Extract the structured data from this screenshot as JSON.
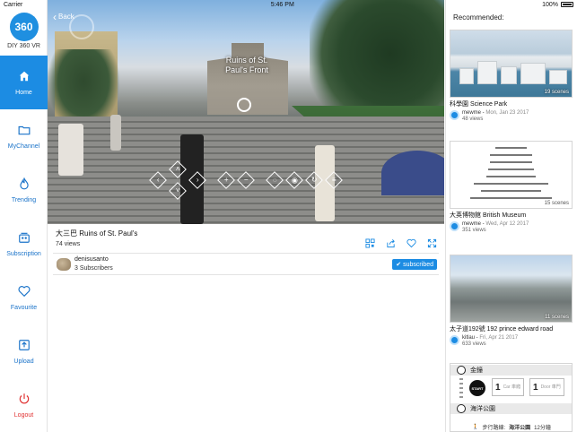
{
  "status_bar": {
    "carrier": "Carrier",
    "time": "5:46 PM",
    "battery": "100%"
  },
  "app": {
    "name": "DIY 360 VR",
    "logo_text": "360"
  },
  "sidebar": {
    "items": [
      {
        "label": "Home",
        "icon": "home-icon",
        "active": true
      },
      {
        "label": "MyChannel",
        "icon": "folder-icon"
      },
      {
        "label": "Trending",
        "icon": "flame-icon"
      },
      {
        "label": "Subscription",
        "icon": "subscription-icon"
      },
      {
        "label": "Favourite",
        "icon": "heart-icon"
      },
      {
        "label": "Upload",
        "icon": "upload-icon"
      },
      {
        "label": "Logout",
        "icon": "power-icon"
      }
    ]
  },
  "viewer": {
    "back_label": "Back",
    "poi_label": "Ruins of St. Paul's Front",
    "controls": [
      "left",
      "up",
      "down",
      "right",
      "zoom-in",
      "zoom-out",
      "comment",
      "eye",
      "refresh",
      "menu"
    ]
  },
  "video": {
    "title": "大三巴 Ruins of St. Paul's",
    "views": "74 views",
    "owner": "denisusanto",
    "subscribers": "3 Subscribers",
    "subscribe_label": "subscribed"
  },
  "recommended": {
    "heading": "Recommended:",
    "items": [
      {
        "title": "科學園 Science Park",
        "scenes": "19 scenes",
        "author": "mewme",
        "date": "Mon, Jan 23 2017",
        "views": "48 views"
      },
      {
        "title": "大英博物館 British Museum",
        "scenes": "15 scenes",
        "author": "mewme",
        "date": "Wed, Apr 12 2017",
        "views": "351 views"
      },
      {
        "title": "太子道192號 192 prince edward road",
        "scenes": "11 scenes",
        "author": "kitlau",
        "date": "Fri, Apr 21 2017",
        "views": "633 views"
      }
    ],
    "transit": {
      "station1": "金鐘",
      "start": "START",
      "car_num": "1",
      "car_label": "Car 車廂",
      "door_num": "1",
      "door_label": "Door 車門",
      "station2": "海洋公園",
      "walk_label": "步行路線:",
      "walk_dest": "海洋公園",
      "walk_extra": "12分鐘"
    }
  },
  "colors": {
    "accent": "#1c8ce3",
    "logout": "#e03030"
  }
}
